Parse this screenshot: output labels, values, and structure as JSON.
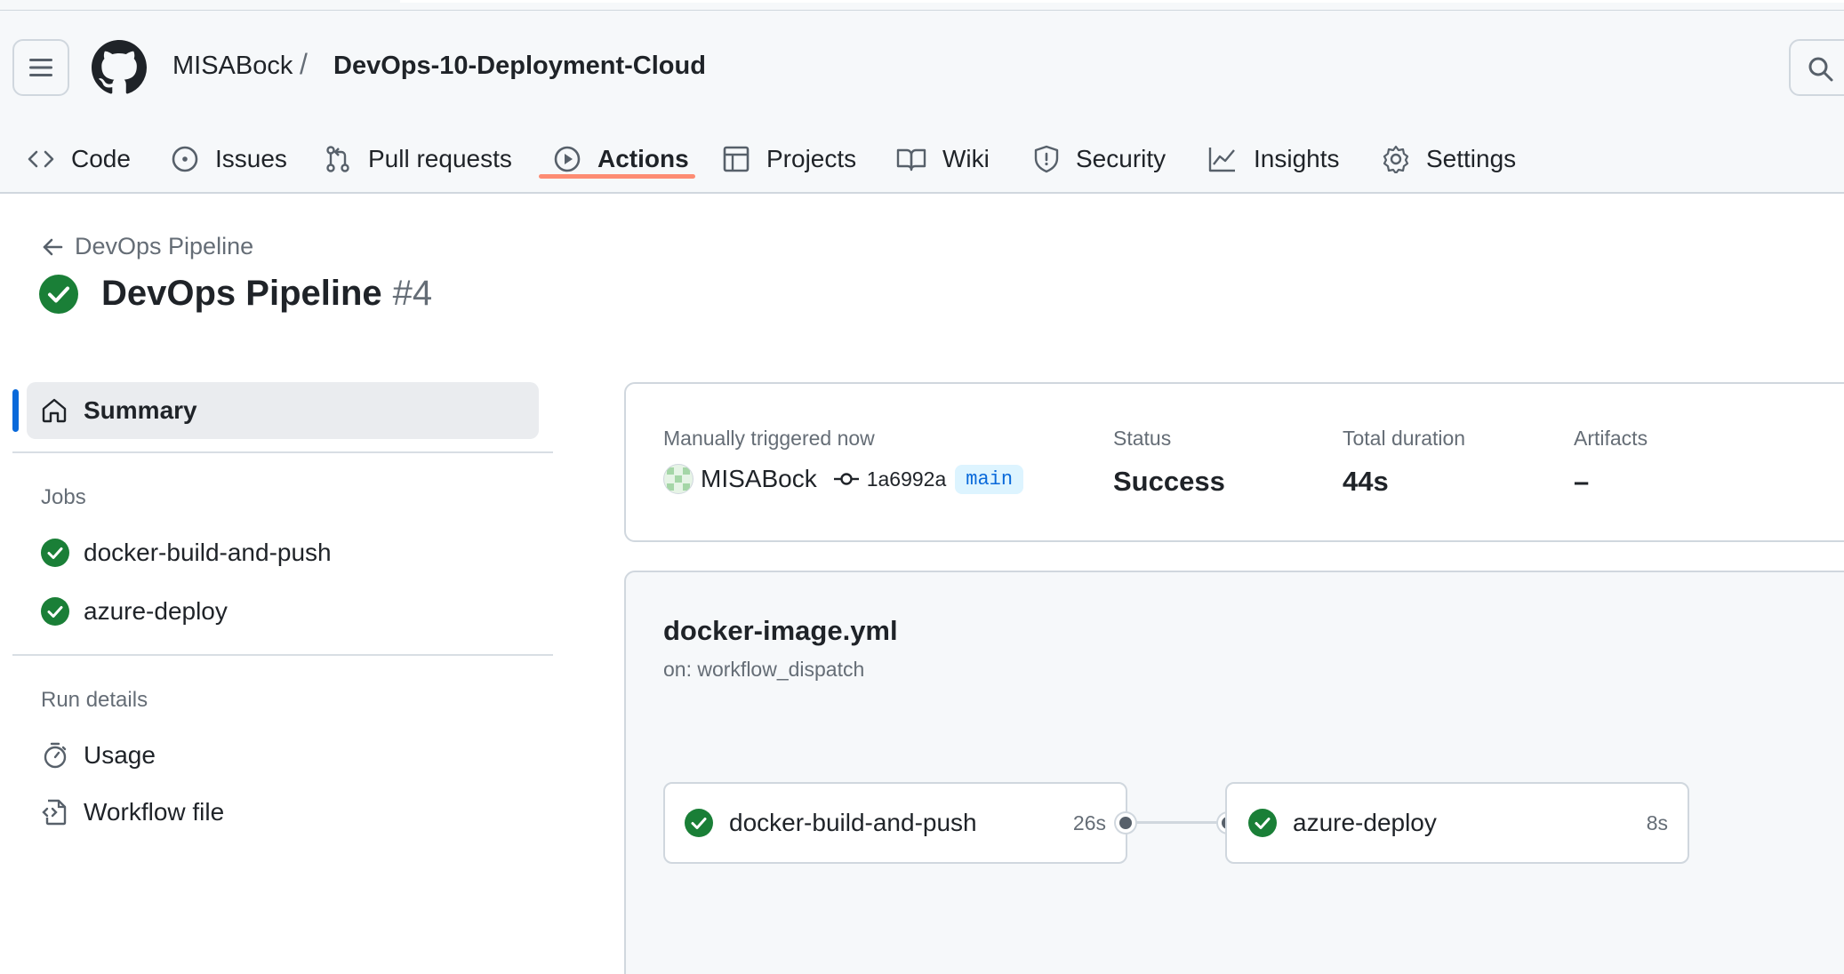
{
  "header": {
    "owner": "MISABock",
    "separator": "/",
    "repo": "DevOps-10-Deployment-Cloud"
  },
  "nav": {
    "items": [
      {
        "label": "Code",
        "icon": "code-icon"
      },
      {
        "label": "Issues",
        "icon": "issue-icon"
      },
      {
        "label": "Pull requests",
        "icon": "pull-request-icon"
      },
      {
        "label": "Actions",
        "icon": "play-icon",
        "active": true
      },
      {
        "label": "Projects",
        "icon": "table-icon"
      },
      {
        "label": "Wiki",
        "icon": "book-icon"
      },
      {
        "label": "Security",
        "icon": "shield-icon"
      },
      {
        "label": "Insights",
        "icon": "graph-icon"
      },
      {
        "label": "Settings",
        "icon": "gear-icon"
      }
    ]
  },
  "page": {
    "back_label": "DevOps Pipeline",
    "title": "DevOps Pipeline",
    "run_number": "#4"
  },
  "sidebar": {
    "summary_label": "Summary",
    "jobs_heading": "Jobs",
    "jobs": [
      "docker-build-and-push",
      "azure-deploy"
    ],
    "run_details_heading": "Run details",
    "usage_label": "Usage",
    "workflow_file_label": "Workflow file"
  },
  "summary": {
    "trigger_label": "Manually triggered now",
    "actor": "MISABock",
    "commit": "1a6992a",
    "branch": "main",
    "status_label": "Status",
    "status_value": "Success",
    "duration_label": "Total duration",
    "duration_value": "44s",
    "artifacts_label": "Artifacts",
    "artifacts_value": "–"
  },
  "workflow": {
    "file": "docker-image.yml",
    "trigger": "on: workflow_dispatch",
    "jobs": [
      {
        "name": "docker-build-and-push",
        "duration": "26s"
      },
      {
        "name": "azure-deploy",
        "duration": "8s"
      }
    ]
  },
  "colors": {
    "success": "#1a7f37",
    "accent": "#0969da",
    "active_tab_underline": "#fd8c73"
  }
}
